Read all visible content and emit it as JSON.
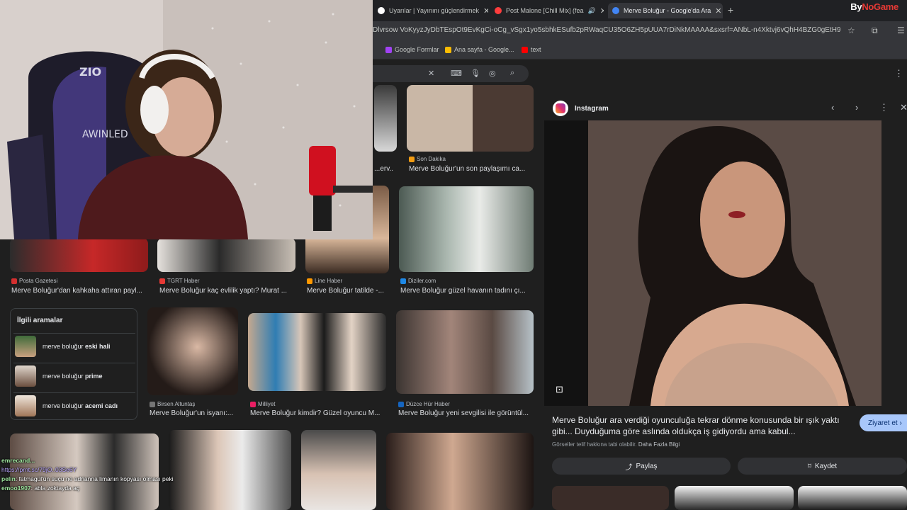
{
  "browser": {
    "tabs": [
      {
        "title": "Uyarılar | Yayınını güçlendirmek",
        "favicon_color": "#ffffff"
      },
      {
        "title": "Post Malone [Chill Mix] (fea",
        "favicon_color": "#ff3d3d"
      },
      {
        "title": "Merve Boluğur - Google'da Ara",
        "favicon_color": "#4285f4"
      }
    ],
    "new_tab_label": "+",
    "url": "Dlvrsow VoKyyzJyDbTEspOt9EvKgCi-oCg_vSgx1yo5sbhkESufb2pRWaqCU35O6ZH5pUUA7rDiNkMAAAA&sxsrf=ANbL-n4Xktvj6vQhH4BZG0gEtH9K_Q-4lw...",
    "bookmarks": [
      {
        "label": "Google Formlar",
        "color": "#a142f4"
      },
      {
        "label": "Ana sayfa - Google...",
        "color": "#fbbc04"
      },
      {
        "label": "text",
        "color": "#ff0000"
      }
    ]
  },
  "watermark": {
    "prefix": "By",
    "brand": "NoGame"
  },
  "search": {
    "results_row1": [
      {
        "source": "",
        "caption": "...erv..."
      },
      {
        "source": "Son Dakika",
        "caption": "Merve Boluğur'un son paylaşımı ca..."
      }
    ],
    "results_row2": [
      {
        "source": "Posta Gazetesi",
        "caption": "Merve Boluğur'dan kahkaha attıran payl..."
      },
      {
        "source": "TGRT Haber",
        "caption": "Merve Boluğur kaç evlilik yaptı? Murat ..."
      },
      {
        "source": "Line Haber",
        "caption": "Merve Boluğur tatilde -..."
      },
      {
        "source": "Diziler.com",
        "caption": "Merve Boluğur güzel havanın tadını çı..."
      }
    ],
    "results_row3": [
      {
        "source": "Birsen Altuntaş",
        "caption": "Merve Boluğur'un isyanı:..."
      },
      {
        "source": "Milliyet",
        "caption": "Merve Boluğur kimdir? Güzel oyuncu M..."
      },
      {
        "source": "Düzce Hür Haber",
        "caption": "Merve Boluğur yeni sevgilisi ile görüntül..."
      }
    ],
    "related": {
      "title": "İlgili aramalar",
      "items": [
        {
          "prefix": "merve boluğur ",
          "bold": "eski hali"
        },
        {
          "prefix": "merve boluğur ",
          "bold": "prime"
        },
        {
          "prefix": "merve boluğur ",
          "bold": "acemi cadı"
        }
      ]
    }
  },
  "preview": {
    "source": "Instagram",
    "title": "Merve Boluğur ara verdiği oyunculuğa tekrar dönme konusunda bir ışık yaktı gibi... Duyduğuma göre aslında oldukça iş gidiyordu ama kabul...",
    "note": "Görseller telif hakkına tabi olabilir.",
    "note_link": "Daha Fazla Bilgi",
    "visit_label": "Ziyaret et",
    "share_label": "Paylaş",
    "save_label": "Kaydet"
  },
  "chat": [
    {
      "user": "emrecand...",
      "text": "https://prnt.sc/79jO..03Se6Y"
    },
    {
      "user": "pelin",
      "text": ": fatmagül'ün suçu ne adrianna limanın kopyası olması peki"
    },
    {
      "user": "emoo1907",
      "text": ": abla zoktayda aç"
    }
  ],
  "stream_cam": {
    "chair_brand": "AWINLED",
    "chair_logo": "ZIO"
  }
}
